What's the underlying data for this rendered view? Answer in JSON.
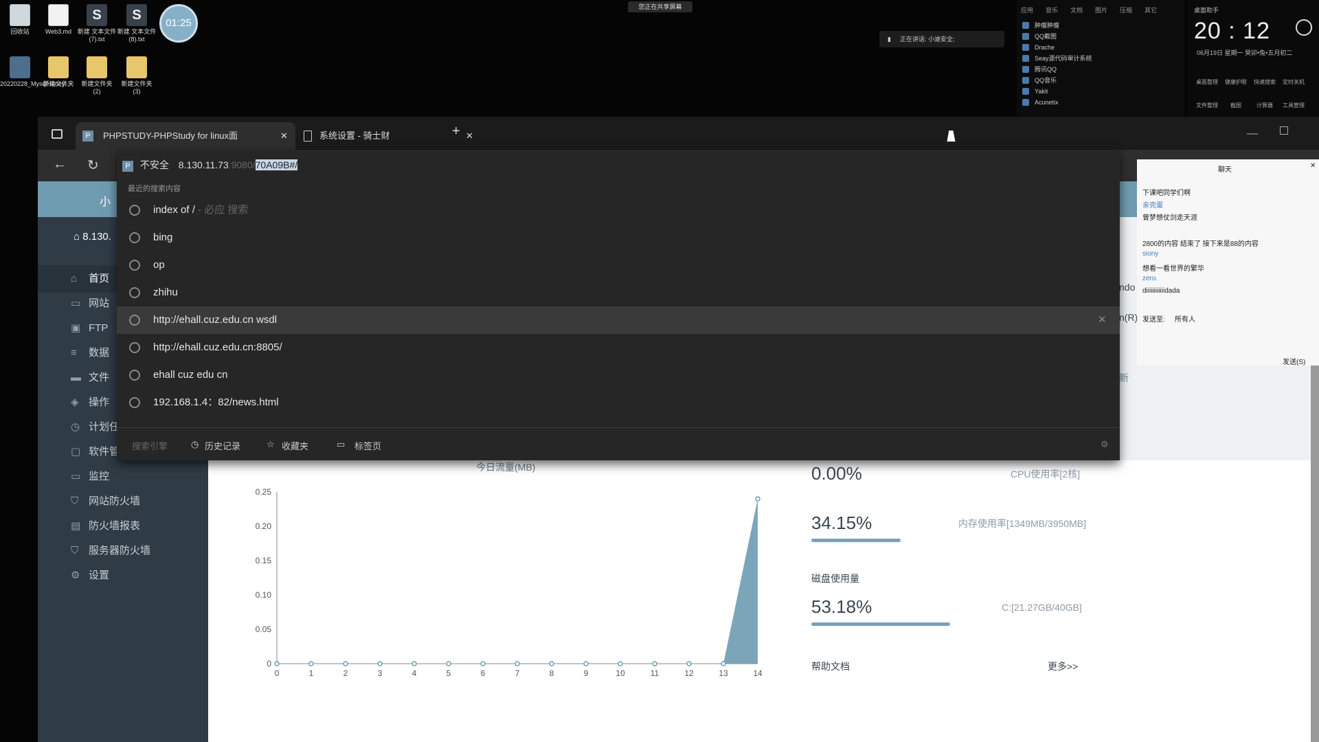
{
  "desktop": {
    "icons": [
      {
        "label": "回收站",
        "icon": "recycle-bin-icon"
      },
      {
        "label": "Web3.md",
        "icon": "document-icon"
      },
      {
        "label": "新建 文本文件 (7).txt",
        "icon": "sublime-text-icon"
      },
      {
        "label": "新建 文本文件 (8).txt",
        "icon": "sublime-text-icon"
      },
      {
        "label": "20220228_MysqlHoney...",
        "icon": "zip-icon"
      },
      {
        "label": "新建文件夹",
        "icon": "folder-icon"
      },
      {
        "label": "新建文件夹 (2)",
        "icon": "folder-icon"
      },
      {
        "label": "新建文件夹 (3)",
        "icon": "folder-icon"
      }
    ],
    "timer": "01:25",
    "share_banner": "您正在共享屏幕",
    "speaking": "正在讲话: 小迪安全;",
    "launcher": {
      "header": [
        "应用",
        "音乐",
        "文档",
        "图片",
        "压缩",
        "其它"
      ],
      "items": [
        "肿瘤肿瘤",
        "QQ截图",
        "Drache",
        "Seay源代码审计系统",
        "腾讯QQ",
        "QQ音乐",
        "Yakit",
        "Acunetix"
      ]
    },
    "clock": {
      "title": "桌面助手",
      "time": "20 : 12",
      "date": "06月19日  星期一  癸卯•兔•五月初二",
      "tools": [
        "桌面整理",
        "健康护眼",
        "快速搜索",
        "定时关机",
        "文件整理",
        "截图",
        "计算器",
        "工具管理"
      ]
    }
  },
  "browser": {
    "tabs": [
      {
        "label": "PHPSTUDY-PHPStudy for linux面",
        "icon": "P"
      },
      {
        "label": "系统设置 - 骑士财",
        "icon": "page-icon"
      }
    ],
    "address": {
      "badge": "P",
      "security": "不安全",
      "host": "8.130.11.73",
      "port": ":9080/",
      "selected": "70A09B#/"
    },
    "dropdown": {
      "title": "最近的搜索内容",
      "items": [
        {
          "text": "index of /",
          "hint": "- 必应 搜索"
        },
        {
          "text": "bing",
          "hint": ""
        },
        {
          "text": "op",
          "hint": ""
        },
        {
          "text": "zhihu",
          "hint": ""
        },
        {
          "text": "http://ehall.cuz.edu.cn wsdl",
          "hint": ""
        },
        {
          "text": "http://ehall.cuz.edu.cn:8805/",
          "hint": ""
        },
        {
          "text": "ehall cuz edu cn",
          "hint": ""
        },
        {
          "text": "192.168.1.4：82/news.html",
          "hint": ""
        }
      ],
      "footer": {
        "search_label": "搜索引擎",
        "history": "历史记录",
        "favorites": "收藏夹",
        "tabs": "标签页"
      }
    }
  },
  "panel": {
    "brand_stub": "小",
    "ip_stub": "8.130.",
    "nav": [
      {
        "label": "首页",
        "icon": "home-icon"
      },
      {
        "label": "网站",
        "icon": "monitor-icon"
      },
      {
        "label": "FTP",
        "icon": "ftp-icon"
      },
      {
        "label": "数据",
        "icon": "database-icon"
      },
      {
        "label": "文件",
        "icon": "folder-icon"
      },
      {
        "label": "操作",
        "icon": "layers-icon"
      },
      {
        "label": "计划任务",
        "icon": "clock-icon"
      },
      {
        "label": "软件管理",
        "icon": "package-icon"
      },
      {
        "label": "监控",
        "icon": "monitor-icon"
      },
      {
        "label": "网站防火墙",
        "icon": "shield-icon"
      },
      {
        "label": "防火墙报表",
        "icon": "report-icon"
      },
      {
        "label": "服务器防火墙",
        "icon": "shield-icon"
      },
      {
        "label": "设置",
        "icon": "gear-icon"
      }
    ],
    "side_fragments": [
      "ndo",
      "n(R)",
      "新"
    ],
    "cpu": {
      "value": "0.00%",
      "label": "CPU使用率[2核]"
    },
    "memory": {
      "value": "34.15%",
      "label": "内存使用率[1349MB/3950MB]",
      "fraction": 0.3415
    },
    "disk_title": "磁盘使用量",
    "disk": {
      "value": "53.18%",
      "label": "C:[21.27GB/40GB]",
      "fraction": 0.5318
    },
    "help": {
      "title": "帮助文档",
      "more": "更多>>"
    }
  },
  "chat": {
    "title": "聊天",
    "lines": [
      {
        "text": "下课吧同学们啊",
        "sender": false
      },
      {
        "text": "亲完蛋",
        "sender": true
      },
      {
        "text": "曾梦想仗剑走天涯",
        "sender": false
      },
      {
        "text": "2800的内容 结束了 接下来是88的内容",
        "sender": false
      },
      {
        "text": "siony",
        "sender": true
      },
      {
        "text": "想看一看世界的繁华",
        "sender": false
      },
      {
        "text": "zero.",
        "sender": true
      },
      {
        "text": "diiiiiiiiiiiidada",
        "sender": false
      }
    ],
    "send_to_label": "发送至:",
    "send_to_value": "所有人",
    "send_button": "发送(S)"
  },
  "chart_data": {
    "type": "area",
    "title": "今日流量(MB)",
    "x": [
      0,
      1,
      2,
      3,
      4,
      5,
      6,
      7,
      8,
      9,
      10,
      11,
      12,
      13,
      14
    ],
    "values": [
      0,
      0,
      0,
      0,
      0,
      0,
      0,
      0,
      0,
      0,
      0,
      0,
      0,
      0,
      0.24
    ],
    "yticks": [
      "0",
      "0.05",
      "0.10",
      "0.15",
      "0.20",
      "0.25"
    ],
    "ylim": [
      0,
      0.25
    ],
    "grid": false,
    "color": "#6f9bb1"
  }
}
